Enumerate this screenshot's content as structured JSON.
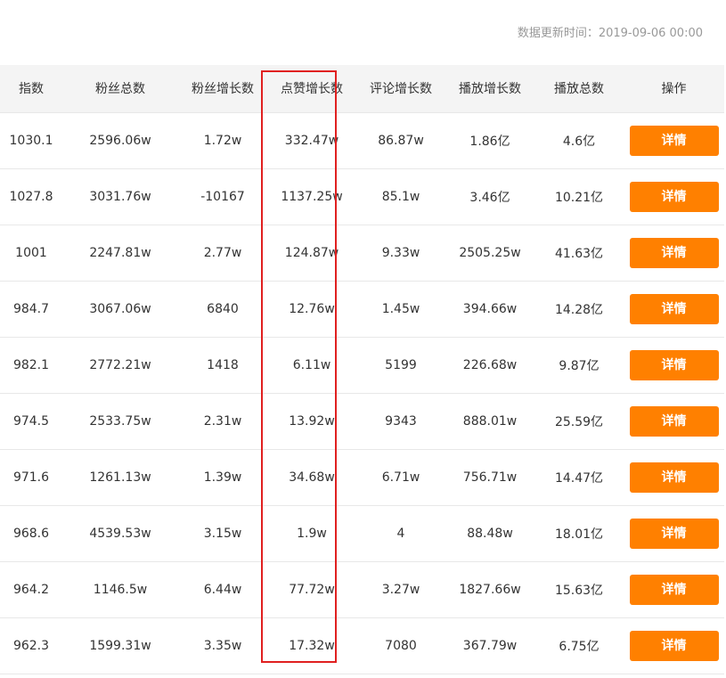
{
  "update_info": {
    "text": "数据更新时间：2019-09-06 00:00"
  },
  "table": {
    "columns": [
      "指数",
      "粉丝总数",
      "粉丝增长数",
      "点赞增长数",
      "评论增长数",
      "播放增长数",
      "播放总数",
      "操作"
    ],
    "action_label": "详情",
    "rows": [
      [
        "1030.1",
        "2596.06w",
        "1.72w",
        "332.47w",
        "86.87w",
        "1.86亿",
        "4.6亿"
      ],
      [
        "1027.8",
        "3031.76w",
        "-10167",
        "1137.25w",
        "85.1w",
        "3.46亿",
        "10.21亿"
      ],
      [
        "1001",
        "2247.81w",
        "2.77w",
        "124.87w",
        "9.33w",
        "2505.25w",
        "41.63亿"
      ],
      [
        "984.7",
        "3067.06w",
        "6840",
        "12.76w",
        "1.45w",
        "394.66w",
        "14.28亿"
      ],
      [
        "982.1",
        "2772.21w",
        "1418",
        "6.11w",
        "5199",
        "226.68w",
        "9.87亿"
      ],
      [
        "974.5",
        "2533.75w",
        "2.31w",
        "13.92w",
        "9343",
        "888.01w",
        "25.59亿"
      ],
      [
        "971.6",
        "1261.13w",
        "1.39w",
        "34.68w",
        "6.71w",
        "756.71w",
        "14.47亿"
      ],
      [
        "968.6",
        "4539.53w",
        "3.15w",
        "1.9w",
        "4",
        "88.48w",
        "18.01亿"
      ],
      [
        "964.2",
        "1146.5w",
        "6.44w",
        "77.72w",
        "3.27w",
        "1827.66w",
        "15.63亿"
      ],
      [
        "962.3",
        "1599.31w",
        "3.35w",
        "17.32w",
        "7080",
        "367.79w",
        "6.75亿"
      ]
    ]
  },
  "colors": {
    "accent": "#ff8000",
    "highlight": "#e02020",
    "header_bg": "#f4f4f4"
  }
}
